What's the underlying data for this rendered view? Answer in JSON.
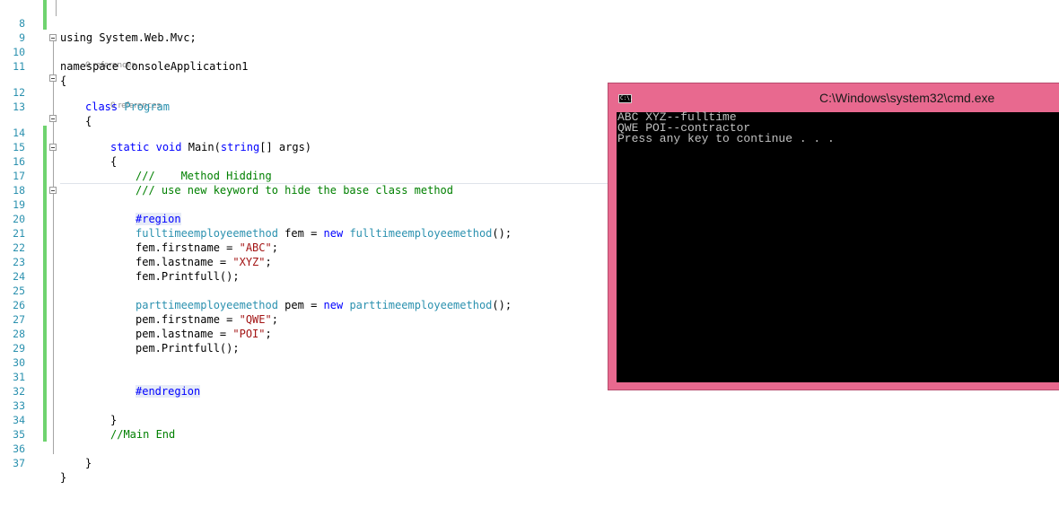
{
  "editor": {
    "lines": [
      {
        "num": "8",
        "code": "using System.Web.Mvc;"
      },
      {
        "num": "9",
        "code": ""
      },
      {
        "num": "10",
        "code": "namespace ConsoleApplication1"
      },
      {
        "num": "11",
        "code": "{"
      },
      {
        "num": "12",
        "kw": "class",
        "name": "Program"
      },
      {
        "num": "13",
        "code": "{"
      },
      {
        "num": "14",
        "static": "static",
        "void": "void",
        "method": "Main(",
        "type": "string",
        "rest": "[] args)"
      },
      {
        "num": "15",
        "code": "{"
      },
      {
        "num": "16",
        "comment": "///    Method Hidding"
      },
      {
        "num": "17",
        "comment": "/// use new keyword to hide the base class method"
      },
      {
        "num": "18",
        "code": ""
      },
      {
        "num": "19",
        "region": "#region"
      },
      {
        "num": "20",
        "type1": "fulltimeemployeemethod",
        "mid": " fem = ",
        "new": "new",
        "type2": "fulltimeemployeemethod",
        "end": "();"
      },
      {
        "num": "21",
        "pre": "fem.firstname = ",
        "str": "\"ABC\"",
        "post": ";"
      },
      {
        "num": "22",
        "pre": "fem.lastname = ",
        "str": "\"XYZ\"",
        "post": ";"
      },
      {
        "num": "23",
        "code": "fem.Printfull();"
      },
      {
        "num": "24",
        "code": ""
      },
      {
        "num": "25",
        "type1": "parttimeemployeemethod",
        "mid": " pem = ",
        "new": "new",
        "type2": "parttimeemployeemethod",
        "end": "();"
      },
      {
        "num": "26",
        "pre": "pem.firstname = ",
        "str": "\"QWE\"",
        "post": ";"
      },
      {
        "num": "27",
        "pre": "pem.lastname = ",
        "str": "\"POI\"",
        "post": ";"
      },
      {
        "num": "28",
        "code": "pem.Printfull();"
      },
      {
        "num": "29",
        "code": ""
      },
      {
        "num": "30",
        "code": ""
      },
      {
        "num": "31",
        "region": "#endregion"
      },
      {
        "num": "32",
        "code": ""
      },
      {
        "num": "33",
        "code": "}"
      },
      {
        "num": "34",
        "comment": "//Main End"
      },
      {
        "num": "35",
        "code": ""
      },
      {
        "num": "36",
        "code": "}"
      },
      {
        "num": "37",
        "code": "}"
      }
    ],
    "references_label": "0 references",
    "namespace_kw": "namespace"
  },
  "console": {
    "title": "C:\\Windows\\system32\\cmd.exe",
    "icon_text": "C:\\.",
    "icon": "console-window-icon",
    "output": [
      "ABC XYZ--fulltime",
      "QWE POI--contractor",
      "Press any key to continue . . ."
    ],
    "colors": {
      "titlebar": "#e8698f",
      "background": "#000000",
      "text": "#c0c0c0"
    }
  }
}
